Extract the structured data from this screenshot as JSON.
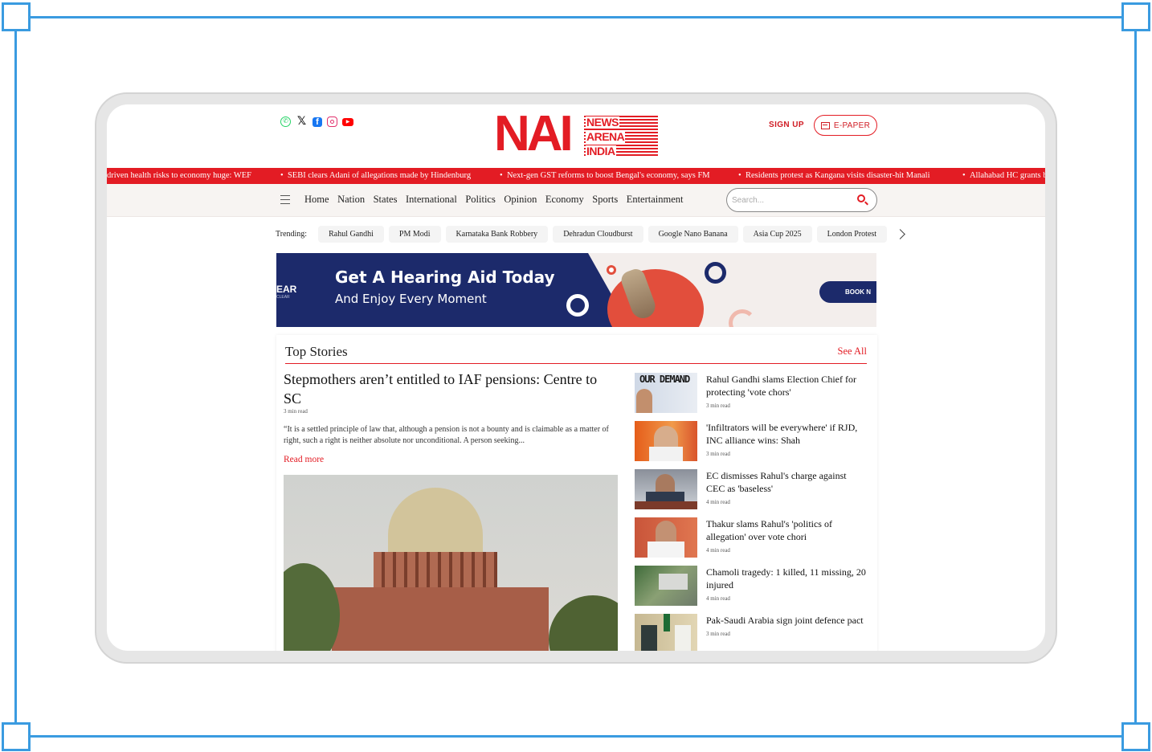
{
  "social_icons": [
    "whatsapp-icon",
    "x-icon",
    "facebook-icon",
    "instagram-icon",
    "youtube-icon"
  ],
  "logo": {
    "main": "NAI",
    "line1": "NEWS",
    "line2": "ARENA",
    "line3": "INDIA"
  },
  "header": {
    "signup": "SIGN UP",
    "epaper": "E-PAPER"
  },
  "ticker": [
    "driven health risks to economy huge: WEF",
    "SEBI clears Adani of allegations made by Hindenburg",
    "Next-gen GST reforms to boost Bengal's economy, says FM",
    "Residents protest as Kangana visits disaster-hit Manali",
    "Allahabad HC grants b"
  ],
  "nav": [
    "Home",
    "Nation",
    "States",
    "International",
    "Politics",
    "Opinion",
    "Economy",
    "Sports",
    "Entertainment"
  ],
  "search": {
    "placeholder": "Search..."
  },
  "trending": {
    "label": "Trending:",
    "items": [
      "Rahul Gandhi",
      "PM Modi",
      "Karnataka Bank Robbery",
      "Dehradun Cloudburst",
      "Google Nano Banana",
      "Asia Cup 2025",
      "London Protest"
    ]
  },
  "ad": {
    "brand": "EAR",
    "brand_sub": "CLEAR",
    "title": "Get A Hearing Aid Today",
    "subtitle": "And Enjoy Every Moment",
    "cta": "BOOK N"
  },
  "top_stories": {
    "heading": "Top Stories",
    "see_all": "See All",
    "main": {
      "title": "Stepmothers aren’t entitled to IAF pensions: Centre to SC",
      "read_time": "3 min read",
      "excerpt": "“It is a settled principle of law that, although a pension is not a bounty and is claimable as a matter of right, such a right is neither absolute nor unconditional. A person seeking...",
      "read_more": "Read more"
    },
    "list": [
      {
        "title": "Rahul Gandhi slams Election Chief for protecting 'vote chors'",
        "read_time": "3 min read",
        "thumb_text": "OUR DEMAND"
      },
      {
        "title": "'Infiltrators will be everywhere' if RJD, INC alliance wins: Shah",
        "read_time": "3 min read"
      },
      {
        "title": "EC dismisses Rahul's charge against CEC as 'baseless'",
        "read_time": "4 min read"
      },
      {
        "title": "Thakur slams Rahul's 'politics of allegation' over vote chori",
        "read_time": "4 min read"
      },
      {
        "title": "Chamoli tragedy: 1 killed, 11 missing, 20 injured",
        "read_time": "4 min read"
      },
      {
        "title": "Pak-Saudi Arabia sign joint defence pact",
        "read_time": "3 min read"
      }
    ]
  },
  "colors": {
    "brand": "#e31c24",
    "frame": "#3a9be0",
    "ad_navy": "#1c2a6b"
  }
}
